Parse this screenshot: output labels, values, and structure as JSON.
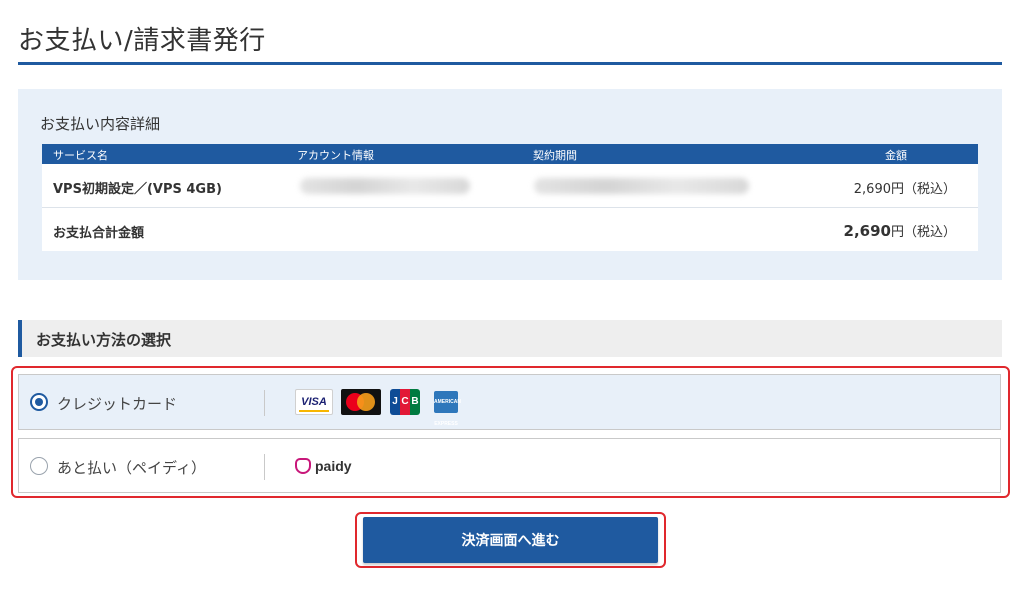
{
  "page": {
    "title": "お支払い/請求書発行"
  },
  "details": {
    "heading": "お支払い内容詳細",
    "columns": [
      "サービス名",
      "アカウント情報",
      "契約期間",
      "金額"
    ],
    "rows": [
      {
        "service": "VPS初期設定／(VPS 4GB)",
        "amount": "2,690円（税込）"
      }
    ],
    "total": {
      "label": "お支払合計金額",
      "amount": "2,690",
      "unit": "円（税込）"
    }
  },
  "payment": {
    "heading": "お支払い方法の選択",
    "options": [
      {
        "label": "クレジットカード",
        "selected": true,
        "logos": [
          "VISA",
          "J",
          "C",
          "B",
          "AMERICAN EXPRESS"
        ]
      },
      {
        "label": "あと払い（ペイディ）",
        "selected": false,
        "logo": "paidy"
      }
    ]
  },
  "submit": {
    "label": "決済画面へ進む"
  },
  "colors": {
    "primary": "#1f5aa0",
    "highlight": "#e0282d",
    "panel": "#e8f0f9"
  }
}
